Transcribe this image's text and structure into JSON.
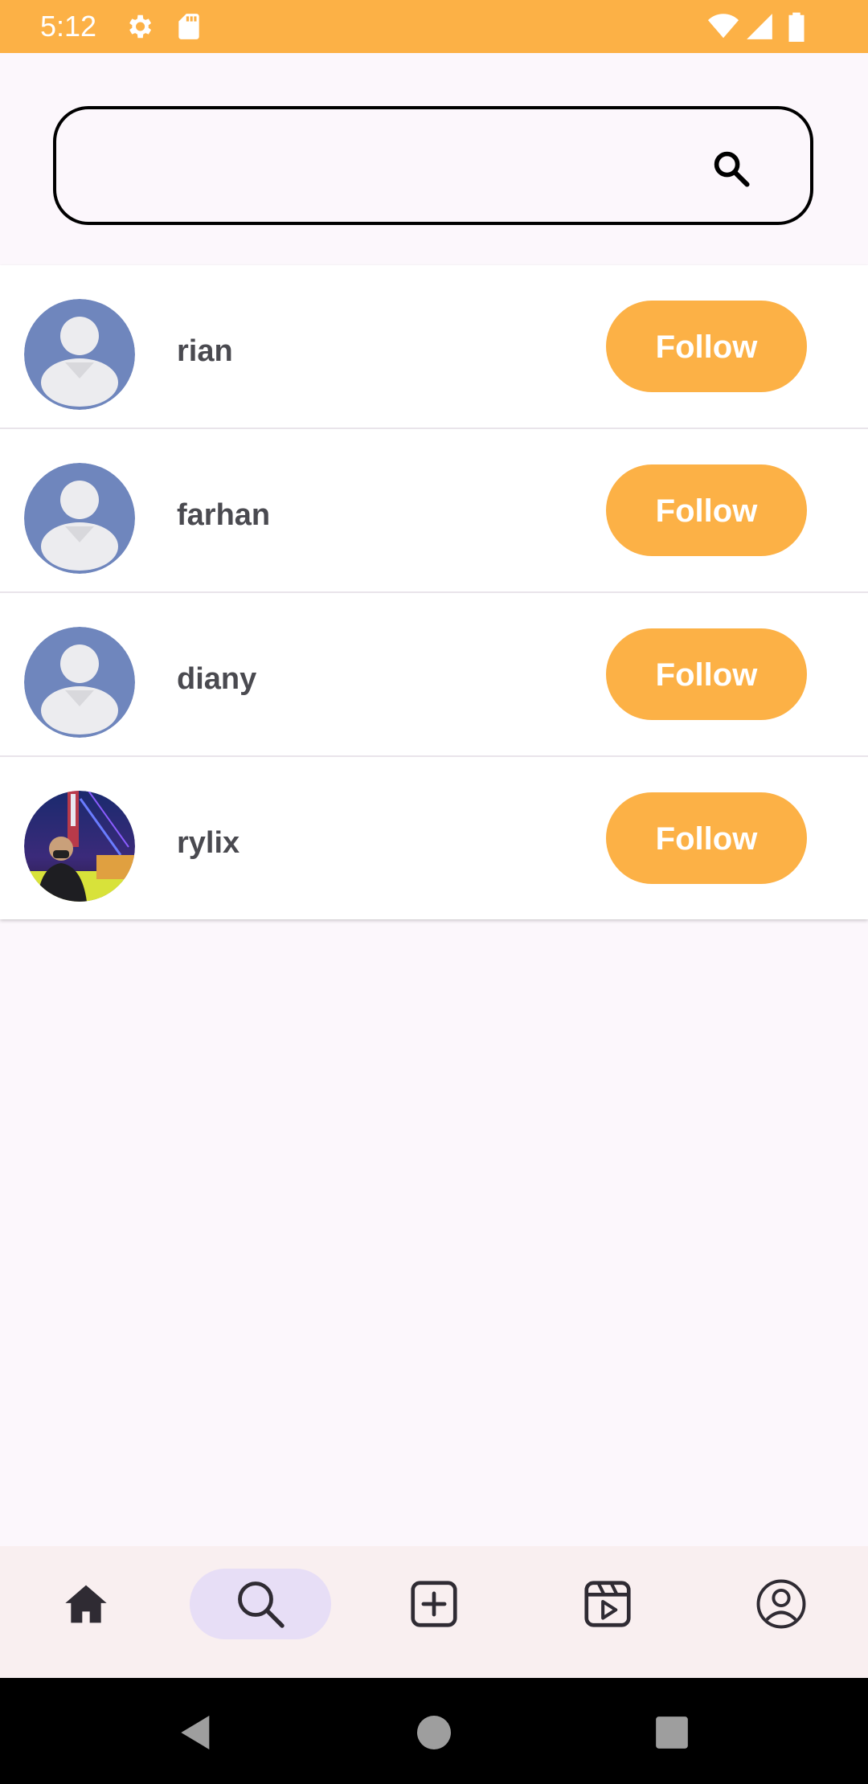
{
  "status_bar": {
    "time": "5:12",
    "icons": [
      "settings-icon",
      "sd-card-icon",
      "wifi-icon",
      "signal-icon",
      "battery-icon"
    ]
  },
  "search": {
    "placeholder": "",
    "value": "",
    "icon": "search-icon"
  },
  "users": [
    {
      "name": "rian",
      "button": "Follow",
      "avatar": "default-avatar-icon"
    },
    {
      "name": "farhan",
      "button": "Follow",
      "avatar": "default-avatar-icon"
    },
    {
      "name": "diany",
      "button": "Follow",
      "avatar": "default-avatar-icon"
    },
    {
      "name": "rylix",
      "button": "Follow",
      "avatar": "photo-avatar"
    }
  ],
  "bottom_nav": {
    "items": [
      {
        "name": "home",
        "icon": "home-icon"
      },
      {
        "name": "search",
        "icon": "search-icon",
        "active": true
      },
      {
        "name": "add",
        "icon": "add-post-icon"
      },
      {
        "name": "reels",
        "icon": "reels-icon"
      },
      {
        "name": "profile",
        "icon": "profile-icon"
      }
    ]
  },
  "colors": {
    "accent": "#fcb146",
    "avatar_bg": "#6f86bd",
    "nav_active": "#e7def6",
    "text": "#4a4a50"
  }
}
